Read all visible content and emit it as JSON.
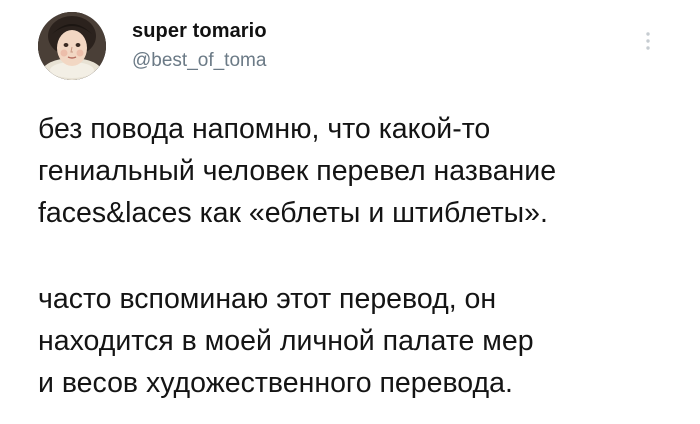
{
  "author": {
    "display_name": "super tomario",
    "handle": "@best_of_toma",
    "avatar_icon": "portrait-avatar"
  },
  "menu": {
    "icon": "more-vertical-icon"
  },
  "tweet": {
    "paragraphs": [
      {
        "lines": [
          "без повода напомню, что какой-то",
          "гениальный человек перевел название",
          "faces&laces как «еблеты и штиблеты»."
        ]
      },
      {
        "lines": [
          "часто вспоминаю этот перевод, он",
          "находится в моей личной палате мер",
          "и весов художественного перевода."
        ]
      }
    ]
  }
}
